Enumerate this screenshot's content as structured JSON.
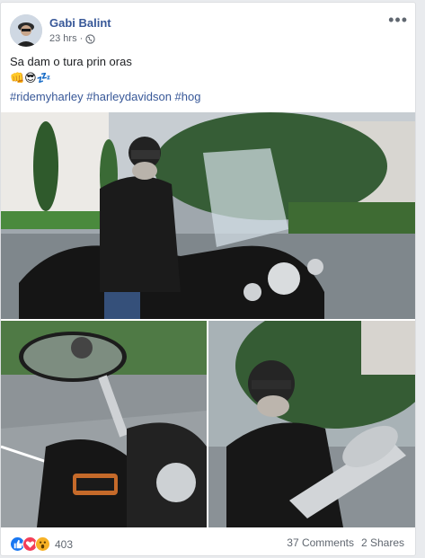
{
  "post": {
    "author": "Gabi Balint",
    "timestamp": "23 hrs",
    "separator": "·",
    "visibility_icon": "globe-icon",
    "more_label": "•••",
    "text": "Sa dam o tura prin oras",
    "emoji_line": "👊😎💤",
    "hashtags": "#ridemyharley #harleydavidson #hog"
  },
  "reactions": {
    "icons": [
      "like-icon",
      "love-icon",
      "wow-icon"
    ],
    "count": "403",
    "comments": "37 Comments",
    "shares": "2 Shares"
  },
  "colors": {
    "link": "#385898",
    "meta": "#616770",
    "like": "#1877f2",
    "love": "#f33e58",
    "wow": "#f7b125"
  }
}
